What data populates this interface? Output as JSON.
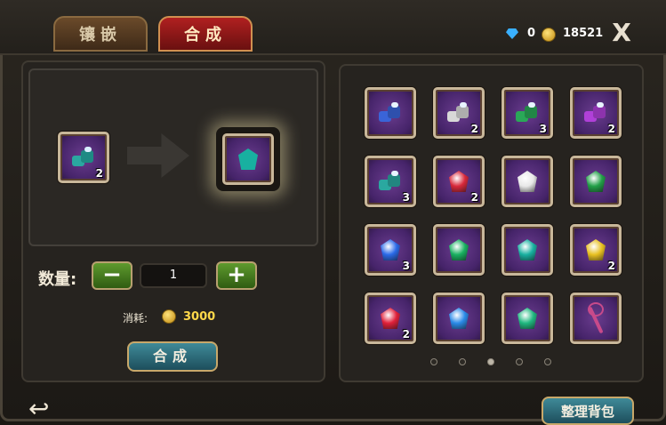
{
  "tabs": [
    {
      "label": "镶嵌",
      "active": false
    },
    {
      "label": "合成",
      "active": true
    }
  ],
  "currency": {
    "diamonds": "0",
    "gold": "18521",
    "diamond_color": "#3ab0ff",
    "gold_color": "#ffd84a"
  },
  "close_label": "X",
  "synthesis": {
    "source_count": "2",
    "quantity_label": "数量:",
    "quantity": "1",
    "minus_label": "−",
    "plus_label": "+",
    "cost_label": "消耗:",
    "cost_value": "3000",
    "combine_button": "合成"
  },
  "inventory": {
    "items": [
      {
        "kind": "ore",
        "color": "#3a64d8",
        "count": "",
        "icon": "blue-ore-icon"
      },
      {
        "kind": "ore",
        "color": "#d8d8d8",
        "count": "2",
        "icon": "silver-ore-icon"
      },
      {
        "kind": "ore",
        "color": "#2aa858",
        "count": "3",
        "icon": "green-ore-icon"
      },
      {
        "kind": "ore",
        "color": "#b040d8",
        "count": "2",
        "icon": "purple-ore-icon"
      },
      {
        "kind": "ore",
        "color": "#2aa8a0",
        "count": "3",
        "icon": "teal-ore-icon"
      },
      {
        "kind": "gem",
        "color": "#d8283a",
        "count": "2",
        "icon": "red-gem-icon"
      },
      {
        "kind": "gem",
        "color": "#e8e8e8",
        "count": "",
        "icon": "white-gem-icon"
      },
      {
        "kind": "gem",
        "color": "#22a048",
        "count": "",
        "icon": "green-gem-icon"
      },
      {
        "kind": "gem",
        "color": "#2a6ae8",
        "count": "3",
        "icon": "blue-gem-icon"
      },
      {
        "kind": "gem",
        "color": "#18b060",
        "count": "",
        "icon": "emerald-gem-icon"
      },
      {
        "kind": "gem",
        "color": "#18b0a0",
        "count": "",
        "icon": "teal-gem-icon"
      },
      {
        "kind": "gem",
        "color": "#e8c020",
        "count": "2",
        "icon": "yellow-gem-icon"
      },
      {
        "kind": "gem",
        "color": "#e0203a",
        "count": "2",
        "icon": "ruby-gem-icon"
      },
      {
        "kind": "gem",
        "color": "#2a8ae8",
        "count": "",
        "icon": "sapphire-gem-icon"
      },
      {
        "kind": "gem",
        "color": "#20b880",
        "count": "",
        "icon": "jade-gem-icon"
      },
      {
        "kind": "staff",
        "color": "#c84a8a",
        "count": "",
        "icon": "staff-icon"
      }
    ],
    "page_count": 5,
    "current_page": 3
  },
  "sort_button": "整理背包",
  "back_icon": "back-arrow-icon"
}
